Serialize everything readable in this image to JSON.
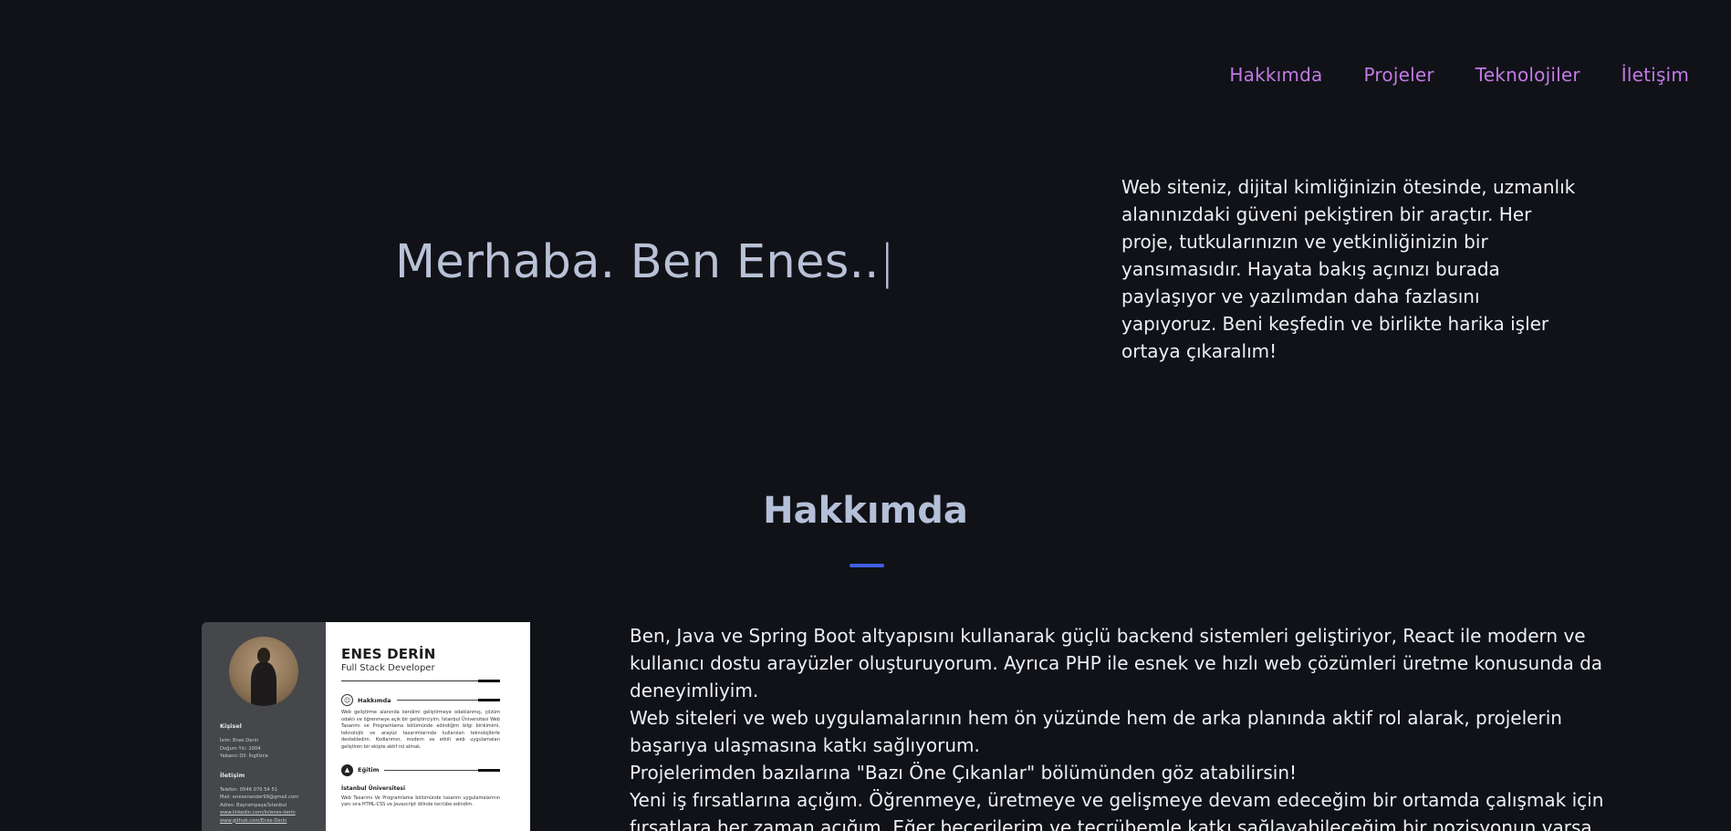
{
  "nav": {
    "items": [
      "Hakkımda",
      "Projeler",
      "Teknolojiler",
      "İletişim"
    ]
  },
  "hero": {
    "title": "Merhaba. Ben Enes..",
    "cursor": "|",
    "description": "Web siteniz, dijital kimliğinizin ötesinde, uzmanlık alanınızdaki güveni pekiştiren bir araçtır. Her proje, tutkularınızın ve yetkinliğinizin bir yansımasıdır. Hayata bakış açınızı burada paylaşıyor ve yazılımdan daha fazlasını yapıyoruz. Beni keşfedin ve birlikte harika işler ortaya çıkaralım!"
  },
  "about": {
    "title": "Hakkımda",
    "paragraphs": [
      "Ben, Java ve Spring Boot altyapısını kullanarak güçlü backend sistemleri geliştiriyor, React ile modern ve kullanıcı dostu arayüzler oluşturuyorum. Ayrıca PHP ile esnek ve hızlı web çözümleri üretme konusunda da deneyimliyim.",
      "Web siteleri ve web uygulamalarının hem ön yüzünde hem de arka planında aktif rol alarak, projelerin başarıya ulaşmasına katkı sağlıyorum.",
      "Projelerimden bazılarına \"Bazı Öne Çıkanlar\" bölümünden göz atabilirsin!",
      "Yeni iş fırsatlarına açığım. Öğrenmeye, üretmeye ve gelişmeye devam edeceğim bir ortamda çalışmak için fırsatlara her zaman açığım. Eğer becerilerim ve tecrübemle katkı sağlayabileceğim bir pozisyonun varsa"
    ]
  },
  "cv": {
    "name": "ENES DERİN",
    "role": "Full Stack Developer",
    "personal_heading": "Kişisel",
    "personal_lines": [
      "İsim: Enes Derin",
      "Doğum Yılı: 2004",
      "Yabancı Dil: İngilizce"
    ],
    "contact_heading": "İletişim",
    "contact_lines": [
      "Telefon: 0546 070 54 51",
      "Mail: enesenesder99@gmail.com",
      "Adres: Bayrampaşa/İstanbul"
    ],
    "contact_links": [
      "www.linkedin.com/in/enes-derin",
      "www.github.com/Enes-Derin"
    ],
    "about_heading": "Hakkımda",
    "about_text": "Web geliştirme alanında kendimi geliştirmeye odaklanmış, çözüm odaklı ve öğrenmeye açık bir geliştiriciyim. İstanbul Üniversitesi Web Tasarımı ve Programlama bölümünde edindiğim bilgi birikimimi, teknolojik ve arayüz tasarımlarında kullanılan teknolojilerle destekledim. Kodlarımın, modern ve etkili web uygulamaları geliştiren bir ekipte aktif rol almak.",
    "education_heading": "Eğitim",
    "school": "İstanbul Üniversitesi",
    "school_text": "Web Tasarımı Ve Programlama bölümünde tasarım uygulamalarının yanı sıra HTML-CSS ve Javascript dilinde tecrübe edindim.",
    "section_icons": [
      "user-icon",
      "graduation-cap-icon"
    ]
  },
  "colors": {
    "background": "#101217",
    "nav_link": "#c479e6",
    "accent_underline": "#3f5fe2",
    "heading": "#b4bfd8"
  }
}
